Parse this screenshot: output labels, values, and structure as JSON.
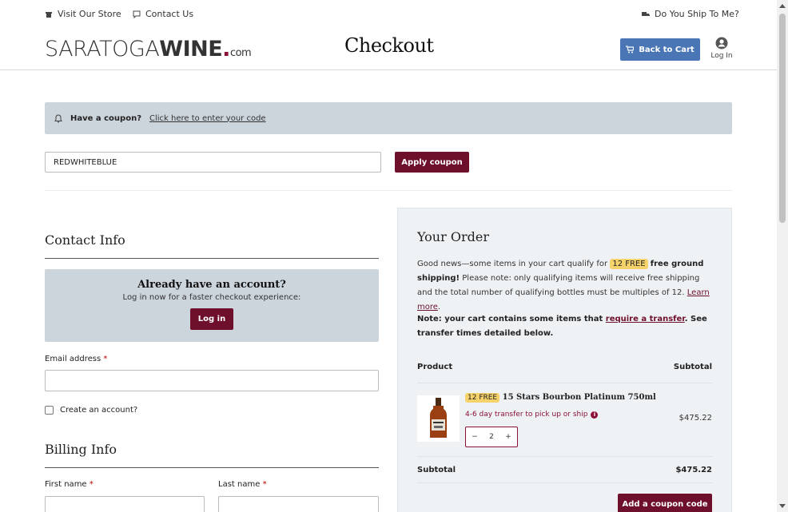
{
  "topbar": {
    "visit_store": "Visit Our Store",
    "contact_us": "Contact Us",
    "ship_to_me": "Do You Ship To Me?",
    "logo_part1": "SARATOGA",
    "logo_part2": "WINE",
    "logo_dot": ".",
    "logo_suffix": "com",
    "page_title": "Checkout",
    "back_to_cart": "Back to Cart",
    "log_in": "Log In"
  },
  "coupon": {
    "prompt": "Have a coupon?",
    "link": "Click here to enter your code",
    "code_value": "REDWHITEBLUE",
    "apply_label": "Apply coupon"
  },
  "contact": {
    "heading": "Contact Info",
    "account_title": "Already have an account?",
    "account_sub": "Log in now for a faster checkout experience:",
    "login_button": "Log in",
    "email_label": "Email address",
    "required_mark": "*",
    "create_account_label": "Create an account?"
  },
  "billing": {
    "heading": "Billing Info",
    "first_name_label": "First name",
    "last_name_label": "Last name"
  },
  "order": {
    "heading": "Your Order",
    "msg_prefix": "Good news—some items in your cart qualify for",
    "free_badge": "12 FREE",
    "msg_bold": "free ground shipping!",
    "msg_rest": "Please note: only qualifying items will receive free shipping and the total number of qualifying bottles must be multiples of 12.",
    "learn_more": "Learn more",
    "note_prefix": "Note: your cart contains some items that",
    "note_link": "require a transfer",
    "note_suffix": ". See transfer times detailed below.",
    "col_product": "Product",
    "col_subtotal": "Subtotal",
    "item": {
      "badge": "12 FREE",
      "name": "15 Stars Bourbon Platinum 750ml",
      "transfer": "4-6 day transfer to pick up or ship",
      "info_icon": "info-icon",
      "qty": "2",
      "minus": "−",
      "plus": "+",
      "price": "$475.22"
    },
    "subtotal_label": "Subtotal",
    "subtotal_value": "$475.22",
    "add_coupon": "Add a coupon code"
  },
  "colors": {
    "burgundy": "#6e0f2b",
    "blue": "#4a76b5",
    "panel": "#cdd5dc",
    "highlight": "#f5d26a"
  }
}
